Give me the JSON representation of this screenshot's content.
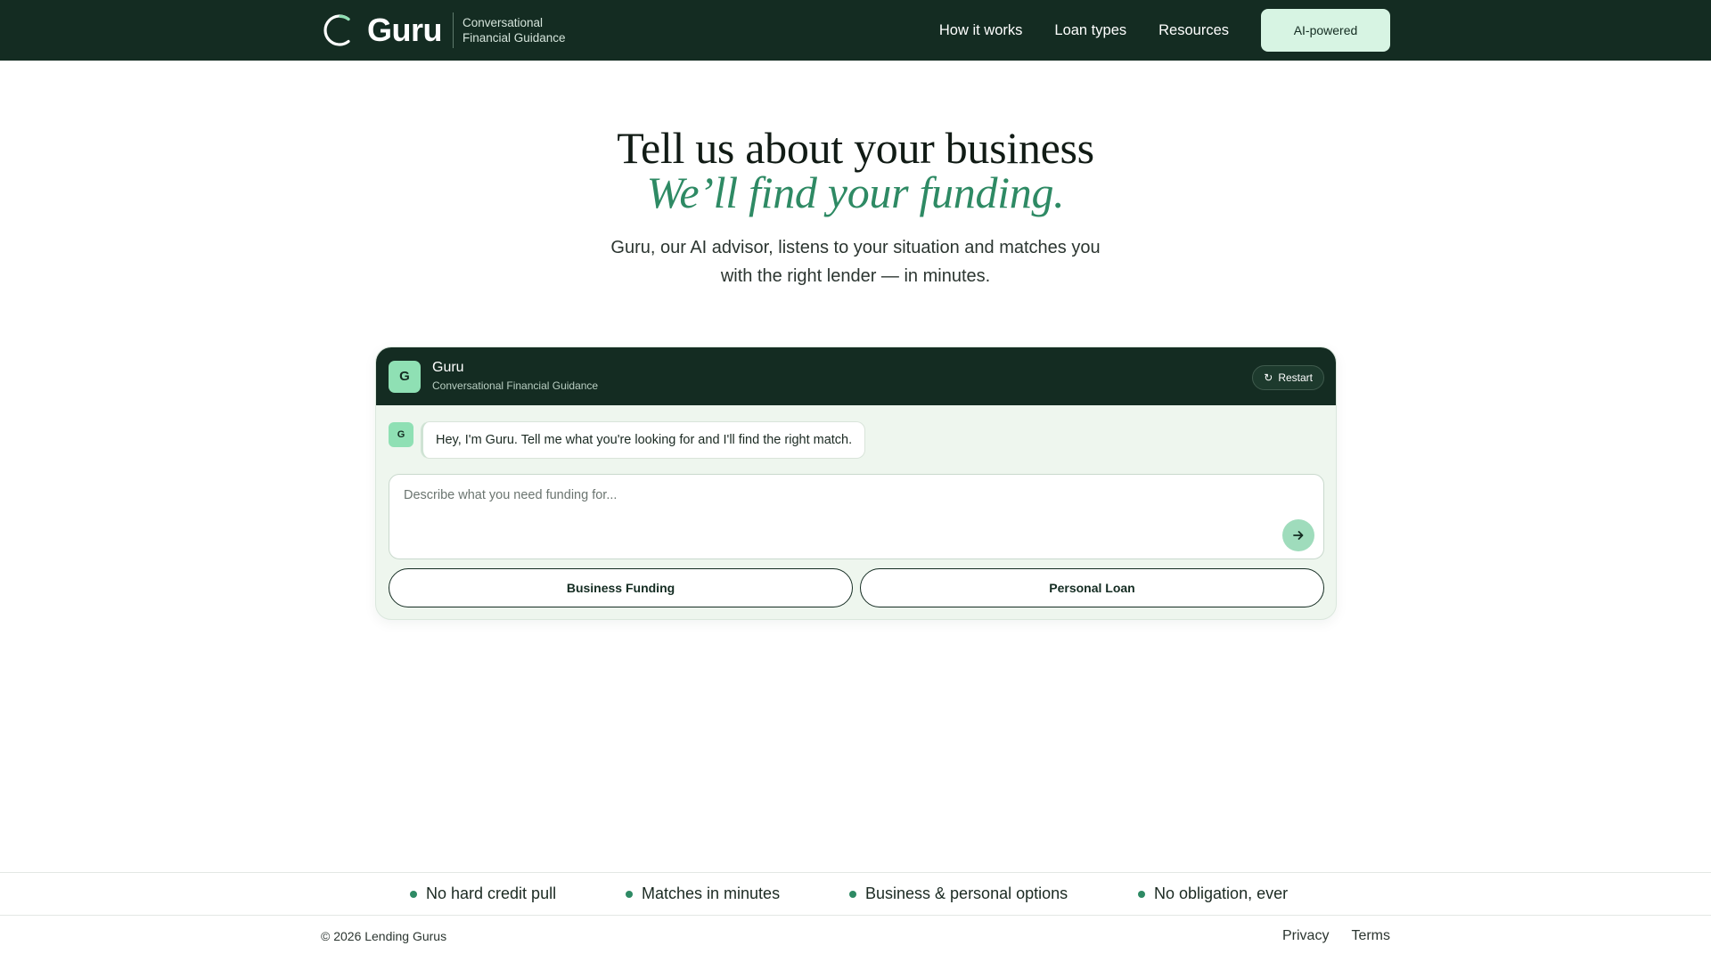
{
  "brand": {
    "name": "Guru",
    "tagline_line1": "Conversational",
    "tagline_line2": "Financial Guidance"
  },
  "nav": {
    "links": [
      "How it works",
      "Loan types",
      "Resources"
    ],
    "cta_label": "AI-powered"
  },
  "hero": {
    "title": "Tell us about your business",
    "title_accent": "We’ll find your funding.",
    "subtitle": "Guru, our AI advisor, listens to your situation and matches you with the right lender — in minutes."
  },
  "chat": {
    "avatar_initial": "G",
    "name": "Guru",
    "description": "Conversational Financial Guidance",
    "restart_icon": "↻",
    "restart_label": "Restart",
    "messages": [
      {
        "sender_initial": "G",
        "text": "Hey, I'm Guru. Tell me what you're looking for and I'll find the right match."
      }
    ],
    "input": {
      "placeholder": "Describe what you need funding for...",
      "value": ""
    },
    "send_icon": "arrow-right-icon",
    "options": [
      "Business Funding",
      "Personal Loan"
    ]
  },
  "features": [
    "No hard credit pull",
    "Matches in minutes",
    "Business & personal options",
    "No obligation, ever"
  ],
  "footer": {
    "copyright": "© 2026 Lending Gurus",
    "links": [
      "Privacy",
      "Terms"
    ]
  },
  "colors": {
    "nav_bg": "#142c22",
    "accent_green": "#2e8a64",
    "mint": "#d7f4e3",
    "chat_bg": "#eef6ee",
    "avatar_mint": "#8fe0b4"
  }
}
